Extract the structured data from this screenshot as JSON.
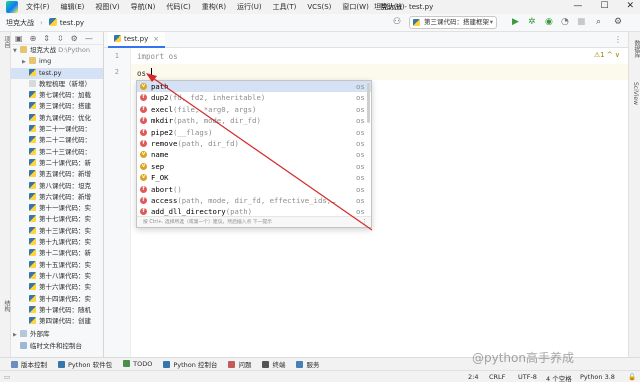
{
  "menubar": {
    "items": [
      "文件(F)",
      "编辑(E)",
      "视图(V)",
      "导航(N)",
      "代码(C)",
      "重构(R)",
      "运行(U)",
      "工具(T)",
      "VCS(S)",
      "窗口(W)",
      "帮助(H)"
    ],
    "window_title": "坦克大战 - test.py",
    "window_buttons": [
      "—",
      "☐",
      "✕"
    ]
  },
  "navbar": {
    "project": "坦克大战",
    "file": "test.py",
    "run_config": "第三课代码：搭建框架",
    "icons": [
      "user-icon",
      "run-config-icon",
      "run-icon",
      "debug-icon",
      "coverage-icon",
      "profile-icon",
      "stop-icon",
      "search-icon",
      "settings-icon"
    ]
  },
  "left_strip": {
    "top_label": "项目",
    "bottom_label": "结构"
  },
  "right_strip": {
    "labels": [
      "数据库",
      "SciView"
    ]
  },
  "project": {
    "toolbar_icons": [
      "project-view-icon",
      "locate-icon",
      "expand-icon",
      "collapse-icon",
      "gear-icon",
      "minimize-icon"
    ],
    "root": {
      "name": "坦克大战",
      "path": "D:\\Python"
    },
    "items": [
      {
        "label": "img",
        "type": "folder"
      },
      {
        "label": "test.py",
        "type": "py",
        "selected": true
      },
      {
        "label": "教程梳理（新增）",
        "type": "txt"
      },
      {
        "label": "第七课代码：加载",
        "type": "py"
      },
      {
        "label": "第三课代码：搭建",
        "type": "py"
      },
      {
        "label": "第九课代码：优化",
        "type": "py"
      },
      {
        "label": "第二十一课代码：",
        "type": "py"
      },
      {
        "label": "第二十二课代码：",
        "type": "py"
      },
      {
        "label": "第二十三课代码：",
        "type": "py"
      },
      {
        "label": "第二十课代码：新",
        "type": "py"
      },
      {
        "label": "第五课代码：新增",
        "type": "py"
      },
      {
        "label": "第八课代码：坦克",
        "type": "py"
      },
      {
        "label": "第六课代码：新增",
        "type": "py"
      },
      {
        "label": "第十一课代码：实",
        "type": "py"
      },
      {
        "label": "第十七课代码：实",
        "type": "py"
      },
      {
        "label": "第十三课代码：实",
        "type": "py"
      },
      {
        "label": "第十九课代码：实",
        "type": "py"
      },
      {
        "label": "第十二课代码：新",
        "type": "py"
      },
      {
        "label": "第十五课代码：实",
        "type": "py"
      },
      {
        "label": "第十八课代码：实",
        "type": "py"
      },
      {
        "label": "第十六课代码：实",
        "type": "py"
      },
      {
        "label": "第十四课代码：实",
        "type": "py"
      },
      {
        "label": "第十课代码：随机",
        "type": "py"
      },
      {
        "label": "第四课代码：创建",
        "type": "py"
      }
    ],
    "external_libs": "外部库",
    "scratches": "临时文件和控制台"
  },
  "editor": {
    "tab_label": "test.py",
    "tab_close": "×",
    "line_numbers": [
      "1",
      "2"
    ],
    "line1_kw": "import",
    "line1_rest": " os",
    "line2": "os.",
    "inspection": "⚠1 ^ ∨"
  },
  "completion": {
    "items": [
      {
        "badge": "v",
        "name": "path",
        "sig": "",
        "mod": "os"
      },
      {
        "badge": "f",
        "name": "dup2",
        "sig": "(fd, fd2, inheritable)",
        "mod": "os"
      },
      {
        "badge": "f",
        "name": "execl",
        "sig": "(file, *arg0, args)",
        "mod": "os"
      },
      {
        "badge": "f",
        "name": "mkdir",
        "sig": "(path, mode, dir_fd)",
        "mod": "os"
      },
      {
        "badge": "f",
        "name": "pipe2",
        "sig": "(__flags)",
        "mod": "os"
      },
      {
        "badge": "f",
        "name": "remove",
        "sig": "(path, dir_fd)",
        "mod": "os"
      },
      {
        "badge": "v",
        "name": "name",
        "sig": "",
        "mod": "os"
      },
      {
        "badge": "v",
        "name": "sep",
        "sig": "",
        "mod": "os"
      },
      {
        "badge": "v",
        "name": "F_OK",
        "sig": "",
        "mod": "os"
      },
      {
        "badge": "f",
        "name": "abort",
        "sig": "()",
        "mod": "os"
      },
      {
        "badge": "f",
        "name": "access",
        "sig": "(path, mode, dir_fd, effective_ids,…",
        "mod": "os"
      },
      {
        "badge": "f",
        "name": "add_dll_directory",
        "sig": "(path)",
        "mod": "os"
      }
    ],
    "footer": "按 Ctrl+. 选择所选（或第一个）建议，然后插入点  下一提示",
    "more": "⋮"
  },
  "bottom_tools": [
    {
      "label": "版本控制"
    },
    {
      "label": "Python 软件包"
    },
    {
      "label": "TODO"
    },
    {
      "label": "Python 控制台"
    },
    {
      "label": "问题"
    },
    {
      "label": "终端"
    },
    {
      "label": "服务"
    }
  ],
  "statusbar": {
    "position": "2:4",
    "line_sep": "CRLF",
    "encoding": "UTF-8",
    "indent": "4 个空格",
    "interpreter": "Python 3.8"
  },
  "watermark": "@python高手养成",
  "colors": {
    "accent": "#3574f0",
    "arrow": "#d42a2a",
    "selection": "#d5e1f5"
  }
}
